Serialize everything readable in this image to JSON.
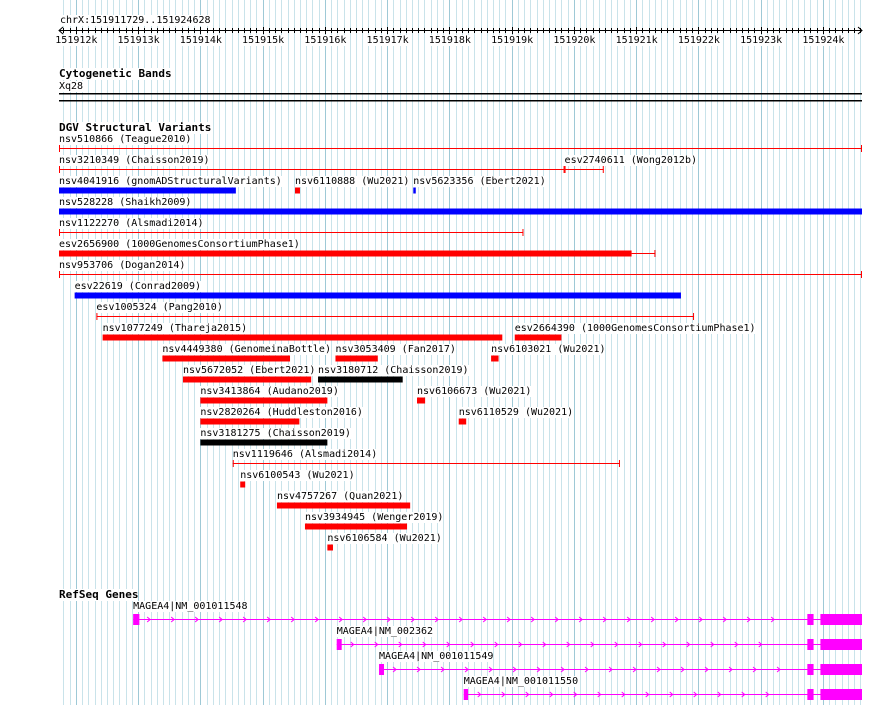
{
  "ruler": {
    "chrom_label": "chrX:151911729..151924628",
    "start": 151911729,
    "end": 151924628,
    "ticks": [
      "151912k",
      "151913k",
      "151914k",
      "151915k",
      "151916k",
      "151917k",
      "151918k",
      "151919k",
      "151920k",
      "151921k",
      "151922k",
      "151923k",
      "151924k"
    ],
    "tick_values": [
      151912000,
      151913000,
      151914000,
      151915000,
      151916000,
      151917000,
      151918000,
      151919000,
      151920000,
      151921000,
      151922000,
      151923000,
      151924000
    ]
  },
  "cytobands": {
    "title": "Cytogenetic Bands",
    "band": "Xq28"
  },
  "dgv": {
    "title": "DGV Structural Variants",
    "colors": {
      "red": "#ff0000",
      "blue": "#0000ff",
      "black": "#000000"
    },
    "variants": [
      {
        "label": "nsv510866 (Teague2010)",
        "row": 0,
        "start": 151911729,
        "end": 151924628,
        "color": "red",
        "style": "thin"
      },
      {
        "label": "nsv3210349 (Chaisson2019)",
        "row": 1,
        "start": 151911729,
        "end": 151919850,
        "color": "red",
        "style": "thin"
      },
      {
        "label": "esv2740611 (Wong2012b)",
        "row": 1,
        "start": 151919850,
        "end": 151920480,
        "color": "red",
        "style": "thin"
      },
      {
        "label": "nsv4041916 (gnomADStructuralVariants)",
        "row": 2,
        "start": 151911729,
        "end": 151914570,
        "color": "blue",
        "style": "thick"
      },
      {
        "label": "nsv6110888 (Wu2021)",
        "row": 2,
        "start": 151915520,
        "end": 151915600,
        "color": "red",
        "style": "thick"
      },
      {
        "label": "nsv5623356 (Ebert2021)",
        "row": 2,
        "start": 151917420,
        "end": 151917460,
        "color": "blue",
        "style": "thick"
      },
      {
        "label": "nsv528228 (Shaikh2009)",
        "row": 3,
        "start": 151911729,
        "end": 151924628,
        "color": "blue",
        "style": "thick"
      },
      {
        "label": "nsv1122270 (Alsmadi2014)",
        "row": 4,
        "start": 151911729,
        "end": 151919190,
        "color": "red",
        "style": "thin"
      },
      {
        "label": "esv2656900 (1000GenomesConsortiumPhase1)",
        "row": 5,
        "start": 151911729,
        "end": 151921310,
        "color": "red",
        "style": "thick-tail"
      },
      {
        "label": "nsv953706 (Dogan2014)",
        "row": 6,
        "start": 151911729,
        "end": 151924628,
        "color": "red",
        "style": "thin"
      },
      {
        "label": "esv22619 (Conrad2009)",
        "row": 7,
        "start": 151911980,
        "end": 151921720,
        "color": "blue",
        "style": "thick"
      },
      {
        "label": "esv1005324 (Pang2010)",
        "row": 8,
        "start": 151912330,
        "end": 151921930,
        "color": "red",
        "style": "thin"
      },
      {
        "label": "nsv1077249 (Thareja2015)",
        "row": 9,
        "start": 151912430,
        "end": 151918850,
        "color": "red",
        "style": "thick"
      },
      {
        "label": "esv2664390 (1000GenomesConsortiumPhase1)",
        "row": 9,
        "start": 151919050,
        "end": 151919800,
        "color": "red",
        "style": "thick"
      },
      {
        "label": "nsv4449380 (GenomeinaBottle)",
        "row": 10,
        "start": 151913390,
        "end": 151915440,
        "color": "red",
        "style": "thick"
      },
      {
        "label": "nsv3053409 (Fan2017)",
        "row": 10,
        "start": 151916170,
        "end": 151916850,
        "color": "red",
        "style": "thick"
      },
      {
        "label": "nsv6103021 (Wu2021)",
        "row": 10,
        "start": 151918670,
        "end": 151918790,
        "color": "red",
        "style": "thick"
      },
      {
        "label": "nsv5672052 (Ebert2021)",
        "row": 11,
        "start": 151913720,
        "end": 151915780,
        "color": "red",
        "style": "thick"
      },
      {
        "label": "nsv3180712 (Chaisson2019)",
        "row": 11,
        "start": 151915890,
        "end": 151917250,
        "color": "black",
        "style": "thick"
      },
      {
        "label": "nsv3413864 (Audano2019)",
        "row": 12,
        "start": 151914000,
        "end": 151916040,
        "color": "red",
        "style": "thick"
      },
      {
        "label": "nsv6106673 (Wu2021)",
        "row": 12,
        "start": 151917480,
        "end": 151917610,
        "color": "red",
        "style": "thick"
      },
      {
        "label": "nsv2820264 (Huddleston2016)",
        "row": 13,
        "start": 151914000,
        "end": 151915590,
        "color": "red",
        "style": "thick"
      },
      {
        "label": "nsv6110529 (Wu2021)",
        "row": 13,
        "start": 151918150,
        "end": 151918270,
        "color": "red",
        "style": "thick"
      },
      {
        "label": "nsv3181275 (Chaisson2019)",
        "row": 14,
        "start": 151914000,
        "end": 151916040,
        "color": "black",
        "style": "thick"
      },
      {
        "label": "nsv1119646 (Alsmadi2014)",
        "row": 15,
        "start": 151914520,
        "end": 151920740,
        "color": "red",
        "style": "thin"
      },
      {
        "label": "nsv6100543 (Wu2021)",
        "row": 16,
        "start": 151914640,
        "end": 151914720,
        "color": "red",
        "style": "thick"
      },
      {
        "label": "nsv4757267 (Quan2021)",
        "row": 17,
        "start": 151915230,
        "end": 151917370,
        "color": "red",
        "style": "thick"
      },
      {
        "label": "nsv3934945 (Wenger2019)",
        "row": 18,
        "start": 151915680,
        "end": 151917320,
        "color": "red",
        "style": "thick"
      },
      {
        "label": "nsv6106584 (Wu2021)",
        "row": 19,
        "start": 151916040,
        "end": 151916130,
        "color": "red",
        "style": "thick"
      }
    ]
  },
  "refseq": {
    "title": "RefSeq Genes",
    "color": "#ff00ff",
    "genes": [
      {
        "label": "MAGEA4|NM_001011548",
        "row": 0,
        "start": 151912920,
        "end": 151924628,
        "exons": [
          [
            151912920,
            151913020
          ],
          [
            151923750,
            151923850
          ],
          [
            151923960,
            151924628
          ]
        ]
      },
      {
        "label": "MAGEA4|NM_002362",
        "row": 1,
        "start": 151916190,
        "end": 151924628,
        "exons": [
          [
            151916190,
            151916270
          ],
          [
            151923750,
            151923850
          ],
          [
            151923960,
            151924628
          ]
        ]
      },
      {
        "label": "MAGEA4|NM_001011549",
        "row": 2,
        "start": 151916870,
        "end": 151924628,
        "exons": [
          [
            151916870,
            151916950
          ],
          [
            151923750,
            151923850
          ],
          [
            151923960,
            151924628
          ]
        ]
      },
      {
        "label": "MAGEA4|NM_001011550",
        "row": 3,
        "start": 151918230,
        "end": 151924628,
        "exons": [
          [
            151918230,
            151918300
          ],
          [
            151923750,
            151923850
          ],
          [
            151923960,
            151924628
          ]
        ]
      }
    ]
  }
}
